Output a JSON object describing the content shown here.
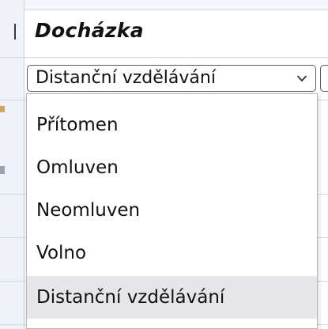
{
  "table": {
    "header_title": "Docházka"
  },
  "select": {
    "value": "Distanční vzdělávání",
    "arrow_icon": "chevron-down-icon"
  },
  "dropdown": {
    "options": [
      {
        "label": "Přítomen"
      },
      {
        "label": "Omluven"
      },
      {
        "label": "Neomluven"
      },
      {
        "label": "Volno"
      },
      {
        "label": "Distanční vzdělávání"
      }
    ],
    "selected_index": 4
  },
  "colors": {
    "selected_background": "#e6e6ea",
    "border": "#5a5a5a",
    "table_line": "#d2d9e6"
  }
}
